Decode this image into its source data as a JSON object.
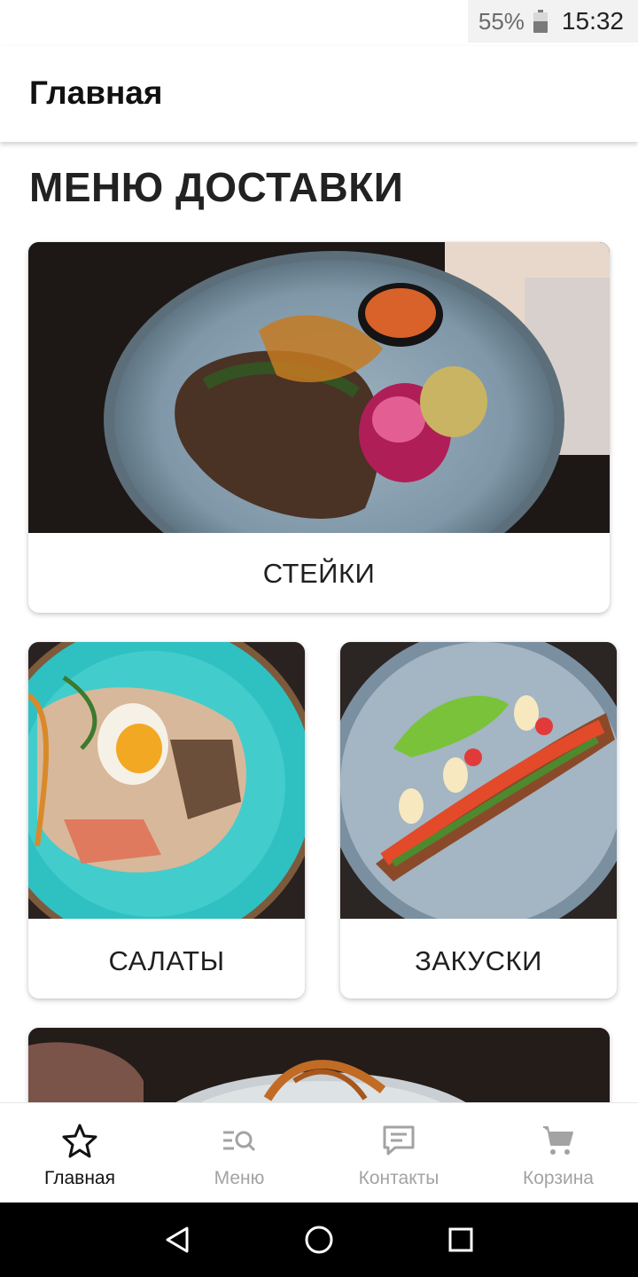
{
  "status_bar": {
    "battery_percent": "55%",
    "battery_level": 0.55,
    "time": "15:32"
  },
  "app_bar": {
    "title": "Главная"
  },
  "main": {
    "section_title": "МЕНЮ ДОСТАВКИ",
    "categories": [
      {
        "label": "СТЕЙКИ",
        "image": "steak-photo"
      },
      {
        "label": "САЛАТЫ",
        "image": "salad-photo"
      },
      {
        "label": "ЗАКУСКИ",
        "image": "appetizer-photo"
      },
      {
        "label": "",
        "image": "dish-photo"
      }
    ]
  },
  "bottom_nav": {
    "items": [
      {
        "label": "Главная",
        "icon": "star-icon",
        "active": true
      },
      {
        "label": "Меню",
        "icon": "menu-search-icon",
        "active": false
      },
      {
        "label": "Контакты",
        "icon": "chat-icon",
        "active": false
      },
      {
        "label": "Корзина",
        "icon": "cart-icon",
        "active": false
      }
    ]
  },
  "colors": {
    "active": "#111111",
    "inactive": "#a3a3a3",
    "plate_blue": "#8fa6b5",
    "plate_turquoise": "#33bfc0"
  },
  "system_nav": {
    "buttons": [
      "back-icon",
      "home-icon",
      "recents-icon"
    ]
  }
}
